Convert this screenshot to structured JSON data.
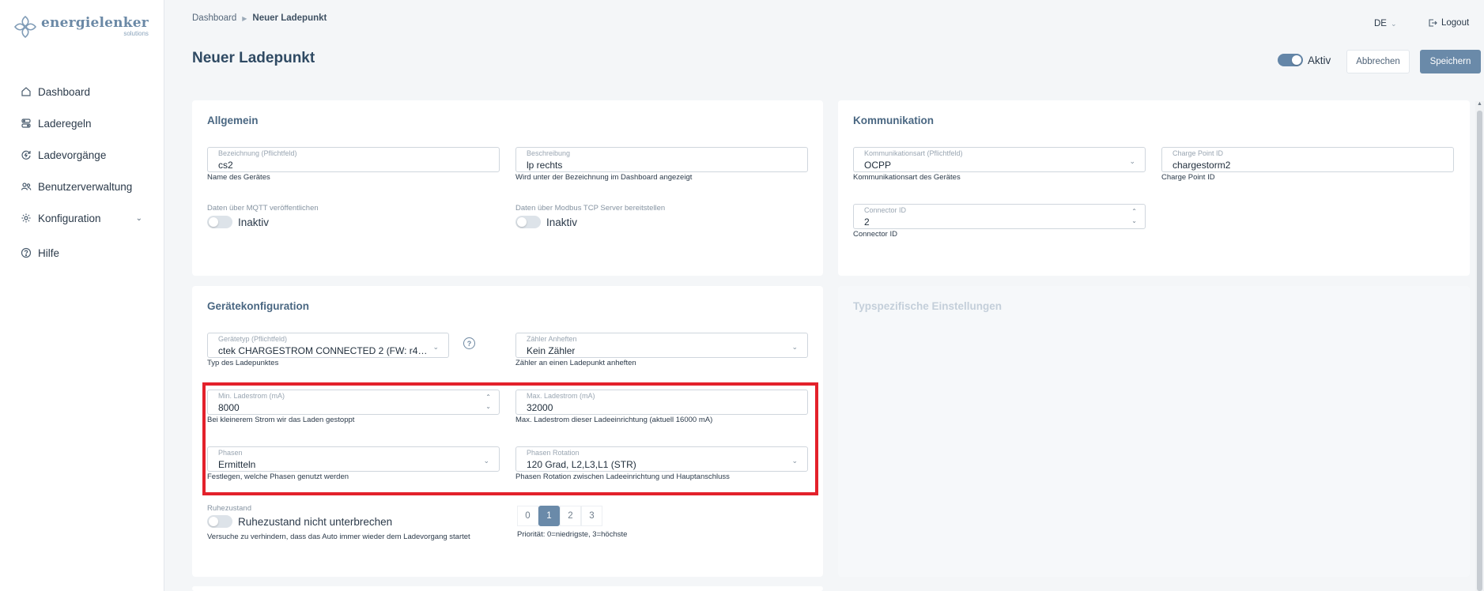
{
  "brand": {
    "name": "energielenker",
    "sub": "solutions"
  },
  "sidebar": {
    "items": [
      {
        "label": "Dashboard",
        "icon": "home-icon"
      },
      {
        "label": "Laderegeln",
        "icon": "rules-icon"
      },
      {
        "label": "Ladevorgänge",
        "icon": "charging-icon"
      },
      {
        "label": "Benutzerverwaltung",
        "icon": "users-icon"
      },
      {
        "label": "Konfiguration",
        "icon": "gear-icon"
      },
      {
        "label": "Hilfe",
        "icon": "help-icon"
      }
    ]
  },
  "breadcrumb": {
    "root": "Dashboard",
    "current": "Neuer Ladepunkt"
  },
  "header": {
    "lang": "DE",
    "logout": "Logout",
    "title": "Neuer Ladepunkt",
    "active_label": "Aktiv",
    "cancel": "Abbrechen",
    "save": "Speichern"
  },
  "allgemein": {
    "title": "Allgemein",
    "bezeichnung": {
      "label": "Bezeichnung (Pflichtfeld)",
      "value": "cs2",
      "hint": "Name des Gerätes"
    },
    "beschreibung": {
      "label": "Beschreibung",
      "value": "lp rechts",
      "hint": "Wird unter der Bezeichnung im Dashboard angezeigt"
    },
    "mqtt": {
      "label": "Daten über MQTT veröffentlichen",
      "state": "Inaktiv"
    },
    "modbus": {
      "label": "Daten über Modbus TCP Server bereitstellen",
      "state": "Inaktiv"
    }
  },
  "kommunikation": {
    "title": "Kommunikation",
    "art": {
      "label": "Kommunikationsart (Pflichtfeld)",
      "value": "OCPP",
      "hint": "Kommunikationsart des Gerätes"
    },
    "cpid": {
      "label": "Charge Point ID",
      "value": "chargestorm2",
      "hint": "Charge Point ID"
    },
    "connector": {
      "label": "Connector ID",
      "value": "2",
      "hint": "Connector ID"
    }
  },
  "geraete": {
    "title": "Gerätekonfiguration",
    "typ": {
      "label": "Gerätetyp (Pflichtfeld)",
      "value": "ctek CHARGESTROM CONNECTED 2 (FW: r4.3.2-0...",
      "hint": "Typ des Ladepunktes"
    },
    "zaehler": {
      "label": "Zähler Anheften",
      "value": "Kein Zähler",
      "hint": "Zähler an einen Ladepunkt anheften"
    },
    "min": {
      "label": "Min. Ladestrom (mA)",
      "value": "8000",
      "hint": "Bei kleinerem Strom wir das Laden gestoppt"
    },
    "max": {
      "label": "Max. Ladestrom (mA)",
      "value": "32000",
      "hint": "Max. Ladestrom dieser Ladeeinrichtung (aktuell 16000 mA)"
    },
    "phasen": {
      "label": "Phasen",
      "value": "Ermitteln",
      "hint": "Festlegen, welche Phasen genutzt werden"
    },
    "rotation": {
      "label": "Phasen Rotation",
      "value": "120 Grad, L2,L3,L1 (STR)",
      "hint": "Phasen Rotation zwischen Ladeeinrichtung und Hauptanschluss"
    },
    "ruhe": {
      "label": "Ruhezustand",
      "switch_label": "Ruhezustand nicht unterbrechen",
      "hint": "Versuche zu verhindern, dass das Auto immer wieder dem Ladevorgang startet"
    },
    "prio": {
      "options": [
        "0",
        "1",
        "2",
        "3"
      ],
      "selected": "1",
      "hint": "Priorität: 0=niedrigste, 3=höchste"
    }
  },
  "typspezifisch": {
    "title": "Typspezifische Einstellungen"
  },
  "colors": {
    "accent": "#6a8aa9",
    "highlight": "#e3212b",
    "title": "#2f4a63"
  }
}
